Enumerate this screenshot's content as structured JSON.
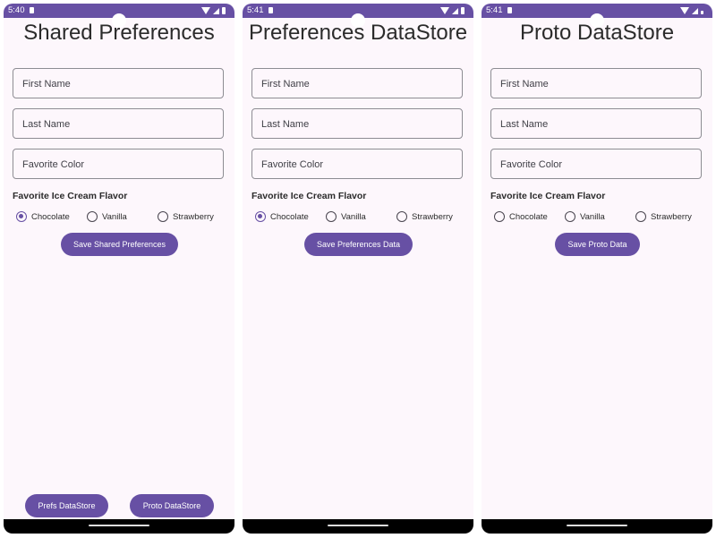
{
  "screens": [
    {
      "status_time": "5:40",
      "title": "Shared Preferences",
      "first_name_placeholder": "First Name",
      "last_name_placeholder": "Last Name",
      "favorite_color_placeholder": "Favorite Color",
      "flavor_label": "Favorite Ice Cream Flavor",
      "flavors": [
        "Chocolate",
        "Vanilla",
        "Strawberry"
      ],
      "selected_flavor": "Chocolate",
      "save_button": "Save Shared Preferences",
      "nav_buttons": [
        "Prefs DataStore",
        "Proto DataStore"
      ]
    },
    {
      "status_time": "5:41",
      "title": "Preferences DataStore",
      "first_name_placeholder": "First Name",
      "last_name_placeholder": "Last Name",
      "favorite_color_placeholder": "Favorite Color",
      "flavor_label": "Favorite Ice Cream Flavor",
      "flavors": [
        "Chocolate",
        "Vanilla",
        "Strawberry"
      ],
      "selected_flavor": "Chocolate",
      "save_button": "Save Preferences Data"
    },
    {
      "status_time": "5:41",
      "title": "Proto DataStore",
      "first_name_placeholder": "First Name",
      "last_name_placeholder": "Last Name",
      "favorite_color_placeholder": "Favorite Color",
      "flavor_label": "Favorite Ice Cream Flavor",
      "flavors": [
        "Chocolate",
        "Vanilla",
        "Strawberry"
      ],
      "selected_flavor": "none",
      "save_button": "Save Proto Data"
    }
  ],
  "colors": {
    "primary": "#6750a4",
    "background": "#fdf7fc",
    "outline": "#8d8d93"
  }
}
